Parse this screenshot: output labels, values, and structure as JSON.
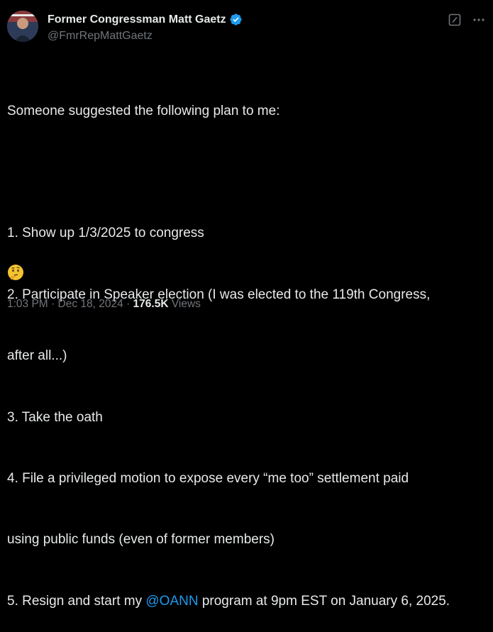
{
  "author": {
    "display_name": "Former Congressman Matt Gaetz",
    "handle": "@FmrRepMattGaetz"
  },
  "tweet": {
    "lines": [
      "Someone suggested the following plan to me:",
      "",
      "1. Show up 1/3/2025 to congress",
      "2. Participate in Speaker election (I was elected to the 119th Congress,",
      "after all...)",
      "3. Take the oath",
      "4. File a privileged motion to expose every “me too” settlement paid",
      "using public funds (even of former members)"
    ],
    "last_line_prefix": "5. Resign and start my ",
    "mention": "@OANN",
    "last_line_suffix": " program at 9pm EST on January 6, 2025.",
    "emoji": "thinking-face"
  },
  "meta": {
    "time": "1:03 PM",
    "date": "Dec 18, 2024",
    "views_count": "176.5K",
    "views_label": "Views",
    "separator": "·"
  },
  "icons": [
    "grok-icon",
    "more-icon",
    "verified-badge-icon"
  ],
  "colors": {
    "background": "#000000",
    "text": "#e7e9ea",
    "muted": "#71767b",
    "link": "#1d9bf0",
    "verified": "#1d9bf0"
  }
}
